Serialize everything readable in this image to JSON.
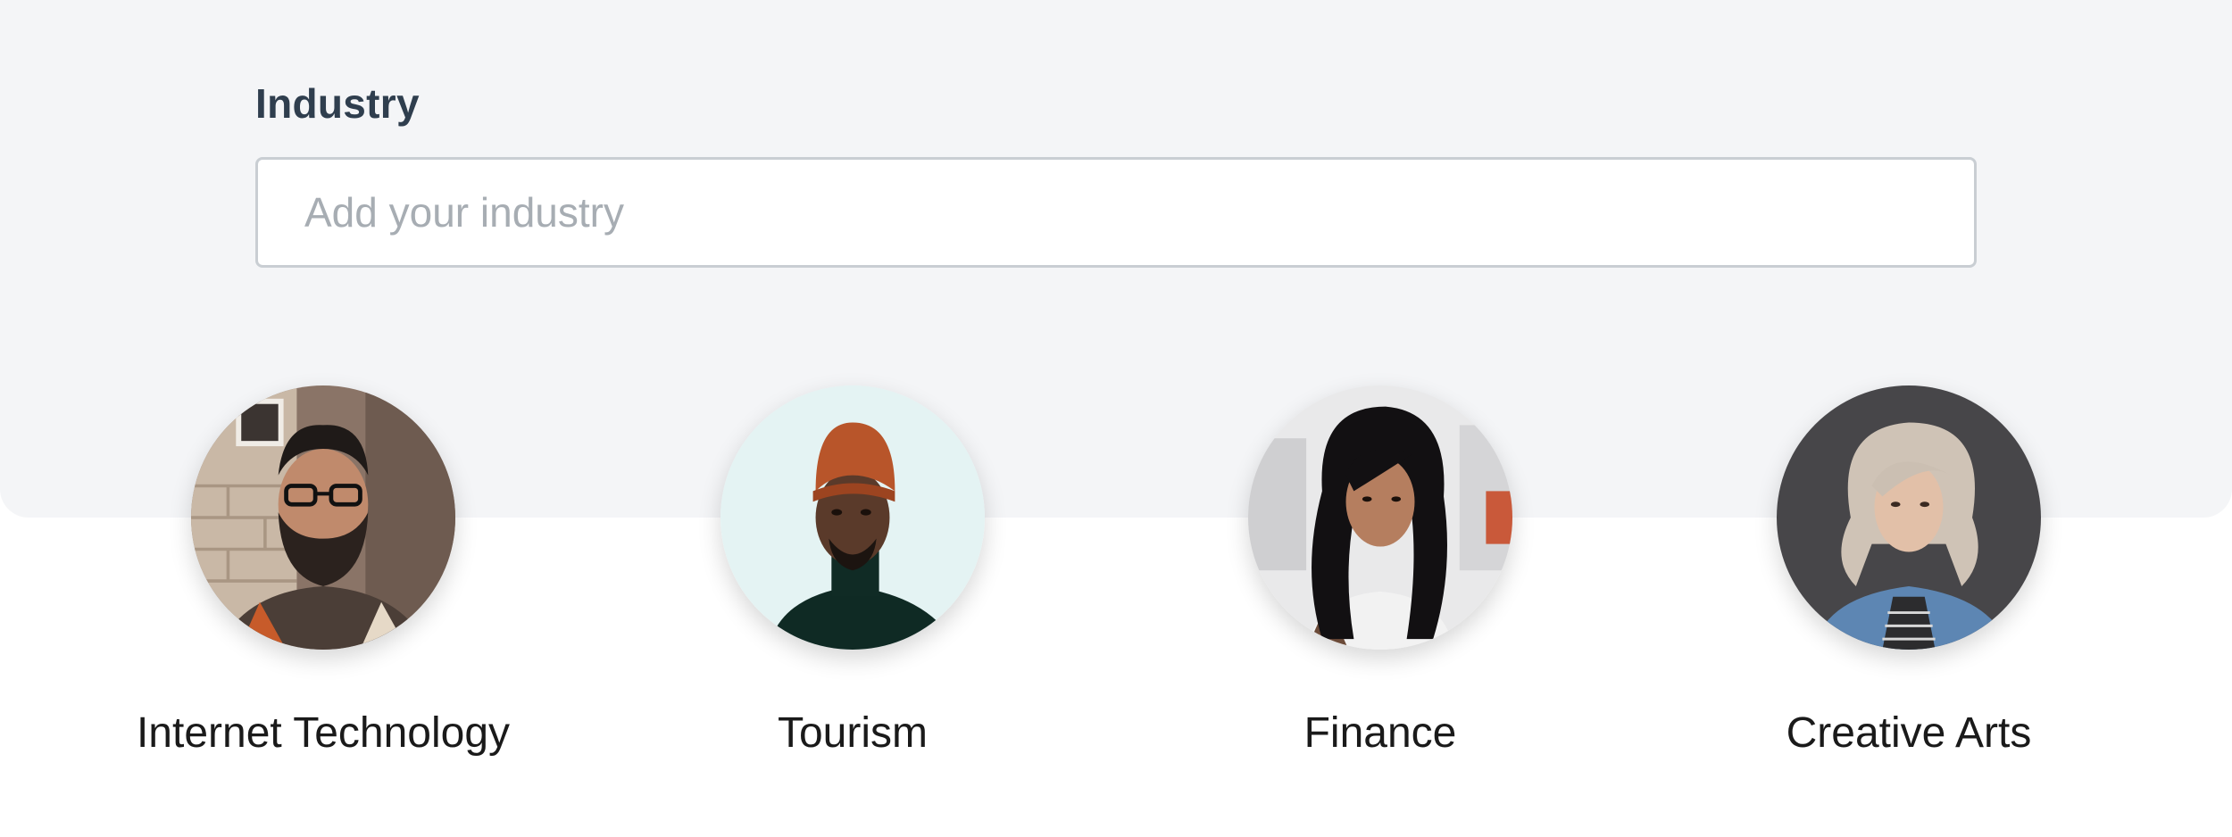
{
  "form": {
    "label": "Industry",
    "placeholder": "Add your industry",
    "value": ""
  },
  "industries": [
    {
      "label": "Internet Technology",
      "avatar": "bearded-man-glasses-photo"
    },
    {
      "label": "Tourism",
      "avatar": "man-orange-beanie-photo"
    },
    {
      "label": "Finance",
      "avatar": "woman-dark-hair-photo"
    },
    {
      "label": "Creative Arts",
      "avatar": "woman-blonde-denim-jacket-photo"
    }
  ],
  "colors": {
    "panel_bg": "#f4f5f7",
    "label_text": "#2f3e4e",
    "placeholder_text": "#a7adb3",
    "input_border": "#c9ced3"
  }
}
